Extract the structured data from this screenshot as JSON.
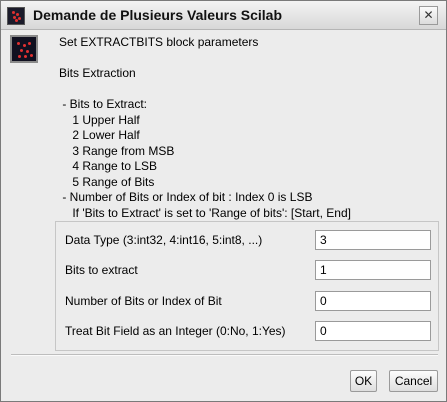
{
  "window": {
    "title": "Demande de Plusieurs Valeurs Scilab",
    "close_glyph": "✕"
  },
  "message": {
    "lines": [
      "Set EXTRACTBITS block parameters",
      "",
      "Bits Extraction",
      "",
      " - Bits to Extract:",
      "    1 Upper Half",
      "    2 Lower Half",
      "    3 Range from MSB",
      "    4 Range to LSB",
      "    5 Range of Bits",
      " - Number of Bits or Index of bit : Index 0 is LSB",
      "    If 'Bits to Extract' is set to 'Range of bits': [Start, End]"
    ]
  },
  "fields": [
    {
      "label": "Data Type (3:int32, 4:int16, 5:int8, ...)",
      "value": "3"
    },
    {
      "label": "Bits to extract",
      "value": "1"
    },
    {
      "label": "Number of Bits or Index of Bit",
      "value": "0"
    },
    {
      "label": "Treat Bit Field as an Integer (0:No, 1:Yes)",
      "value": "0"
    }
  ],
  "buttons": {
    "ok": "OK",
    "cancel": "Cancel"
  },
  "icons": {
    "title": "scilab-app-icon",
    "message": "scilab-message-icon",
    "close": "close-icon"
  }
}
